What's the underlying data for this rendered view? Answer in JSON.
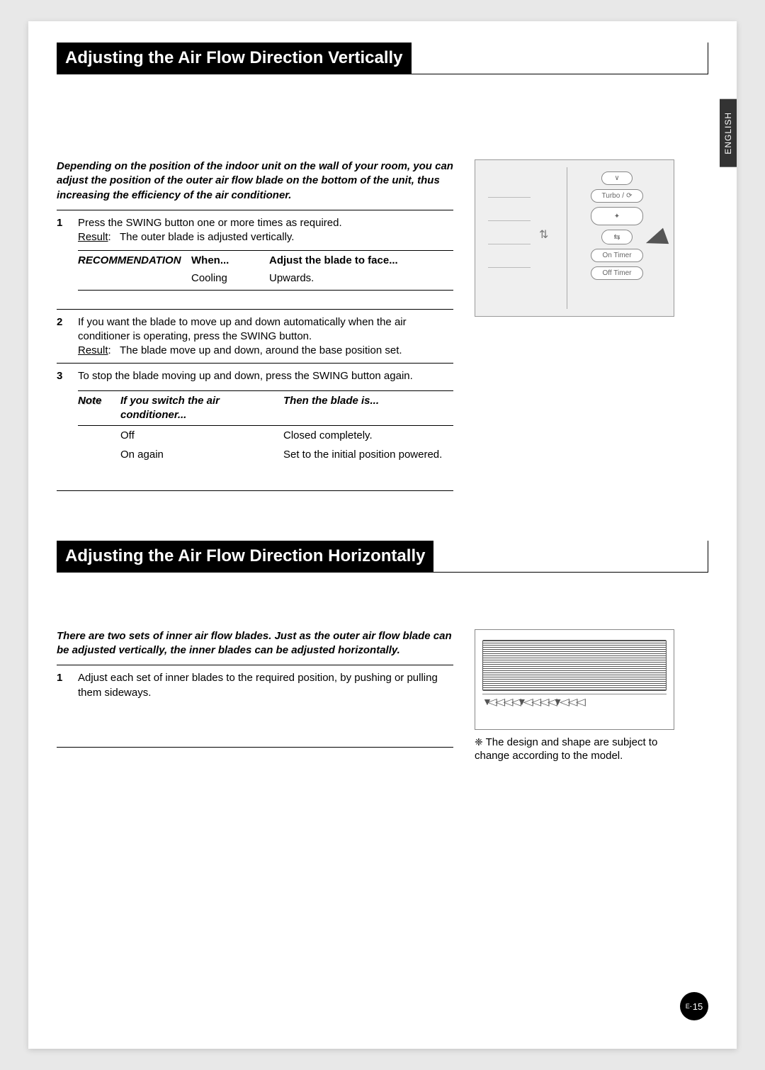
{
  "language_tab": "ENGLISH",
  "section1": {
    "title": "Adjusting the Air Flow Direction Vertically",
    "intro": "Depending on the position of the indoor unit on the wall of your room, you can adjust the position of the outer air flow blade on the bottom of the unit, thus increasing the efficiency of the air conditioner.",
    "step1": {
      "num": "1",
      "text": "Press the SWING button one or more times as required.",
      "result_label": "Result",
      "result_text": "The outer blade is adjusted vertically."
    },
    "rec": {
      "label": "RECOMMENDATION",
      "h1": "When...",
      "h2": "Adjust the blade to face...",
      "c1": "Cooling",
      "c2": "Upwards."
    },
    "step2": {
      "num": "2",
      "text": "If you want the blade to move up and down automatically when the air conditioner is operating, press the SWING button.",
      "result_label": "Result",
      "result_text": "The blade move up and down, around the base position set."
    },
    "step3": {
      "num": "3",
      "text": "To stop the blade moving up and down, press the SWING button again."
    },
    "note": {
      "label": "Note",
      "h1": "If you switch the air conditioner...",
      "h2": "Then the blade is...",
      "r1c1": "Off",
      "r1c2": "Closed completely.",
      "r2c1": "On again",
      "r2c2": "Set to the initial position powered."
    }
  },
  "remote": {
    "btn_v": "∨",
    "btn_turbo": "Turbo",
    "btn_swing": "⇅",
    "btn_swing2": "⇆",
    "btn_ontimer": "On Timer",
    "btn_offtimer": "Off Timer"
  },
  "section2": {
    "title": "Adjusting the Air Flow Direction Horizontally",
    "intro": "There are two sets of inner air flow blades. Just as the outer air flow blade can be adjusted vertically, the inner blades can be adjusted horizontally.",
    "step1": {
      "num": "1",
      "text": "Adjust each set of inner blades to the required position, by pushing or pulling them sideways."
    },
    "caption_ast": "❈",
    "caption": "The design and shape are subject to change according to the model."
  },
  "page_num_prefix": "E-",
  "page_num": "15"
}
